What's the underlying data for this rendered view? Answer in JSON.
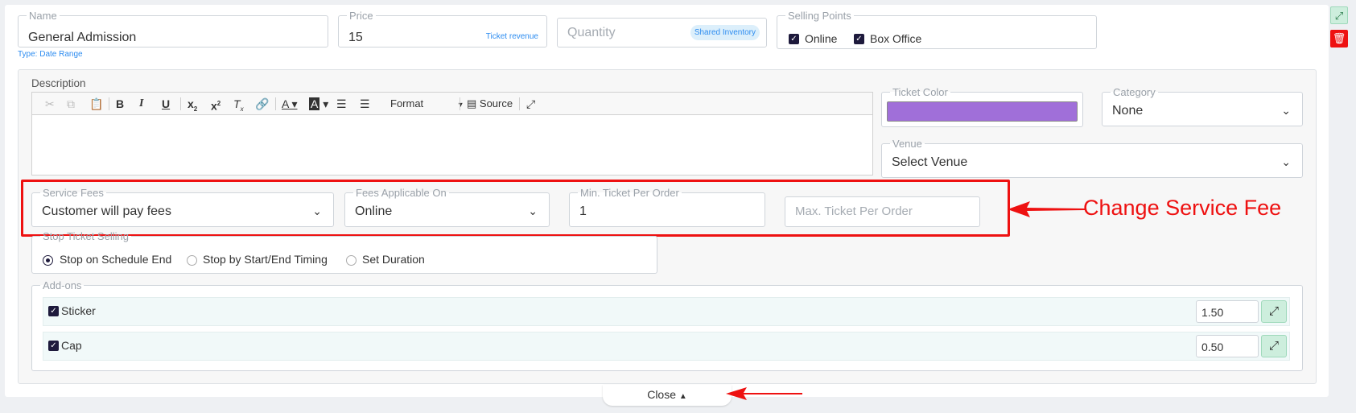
{
  "top_fields": {
    "name": {
      "label": "Name",
      "value": "General Admission",
      "hint": "Type: Date Range"
    },
    "price": {
      "label": "Price",
      "value": "15",
      "badge": "Ticket revenue"
    },
    "quantity": {
      "placeholder": "Quantity",
      "badge": "Shared Inventory"
    },
    "selling_points": {
      "label": "Selling Points",
      "options": [
        {
          "label": "Online",
          "checked": true
        },
        {
          "label": "Box Office",
          "checked": true
        }
      ]
    }
  },
  "description": {
    "label": "Description",
    "toolbar": {
      "format_label": "Format",
      "source_label": "Source"
    }
  },
  "ticket_color": {
    "label": "Ticket Color",
    "value": "#a06fd9"
  },
  "category": {
    "label": "Category",
    "value": "None"
  },
  "venue": {
    "label": "Venue",
    "value": "Select Venue"
  },
  "fees": {
    "service_fees": {
      "label": "Service Fees",
      "value": "Customer will pay fees"
    },
    "applicable_on": {
      "label": "Fees Applicable On",
      "value": "Online"
    },
    "min_ticket": {
      "label": "Min. Ticket Per Order",
      "value": "1"
    },
    "max_ticket": {
      "placeholder": "Max. Ticket Per Order"
    }
  },
  "stop_selling": {
    "label": "Stop Ticket Selling",
    "options": [
      {
        "label": "Stop on Schedule End",
        "selected": true
      },
      {
        "label": "Stop by Start/End Timing",
        "selected": false
      },
      {
        "label": "Set Duration",
        "selected": false
      }
    ]
  },
  "addons": {
    "label": "Add-ons",
    "items": [
      {
        "name": "Sticker",
        "price": "1.50",
        "checked": true
      },
      {
        "name": "Cap",
        "price": "0.50",
        "checked": true
      }
    ]
  },
  "annotation": {
    "text": "Change Service Fee",
    "color": "#ee1111"
  },
  "close_label": "Close",
  "side_buttons": {
    "expand_icon": "expand-icon",
    "delete_icon": "trash-icon"
  }
}
